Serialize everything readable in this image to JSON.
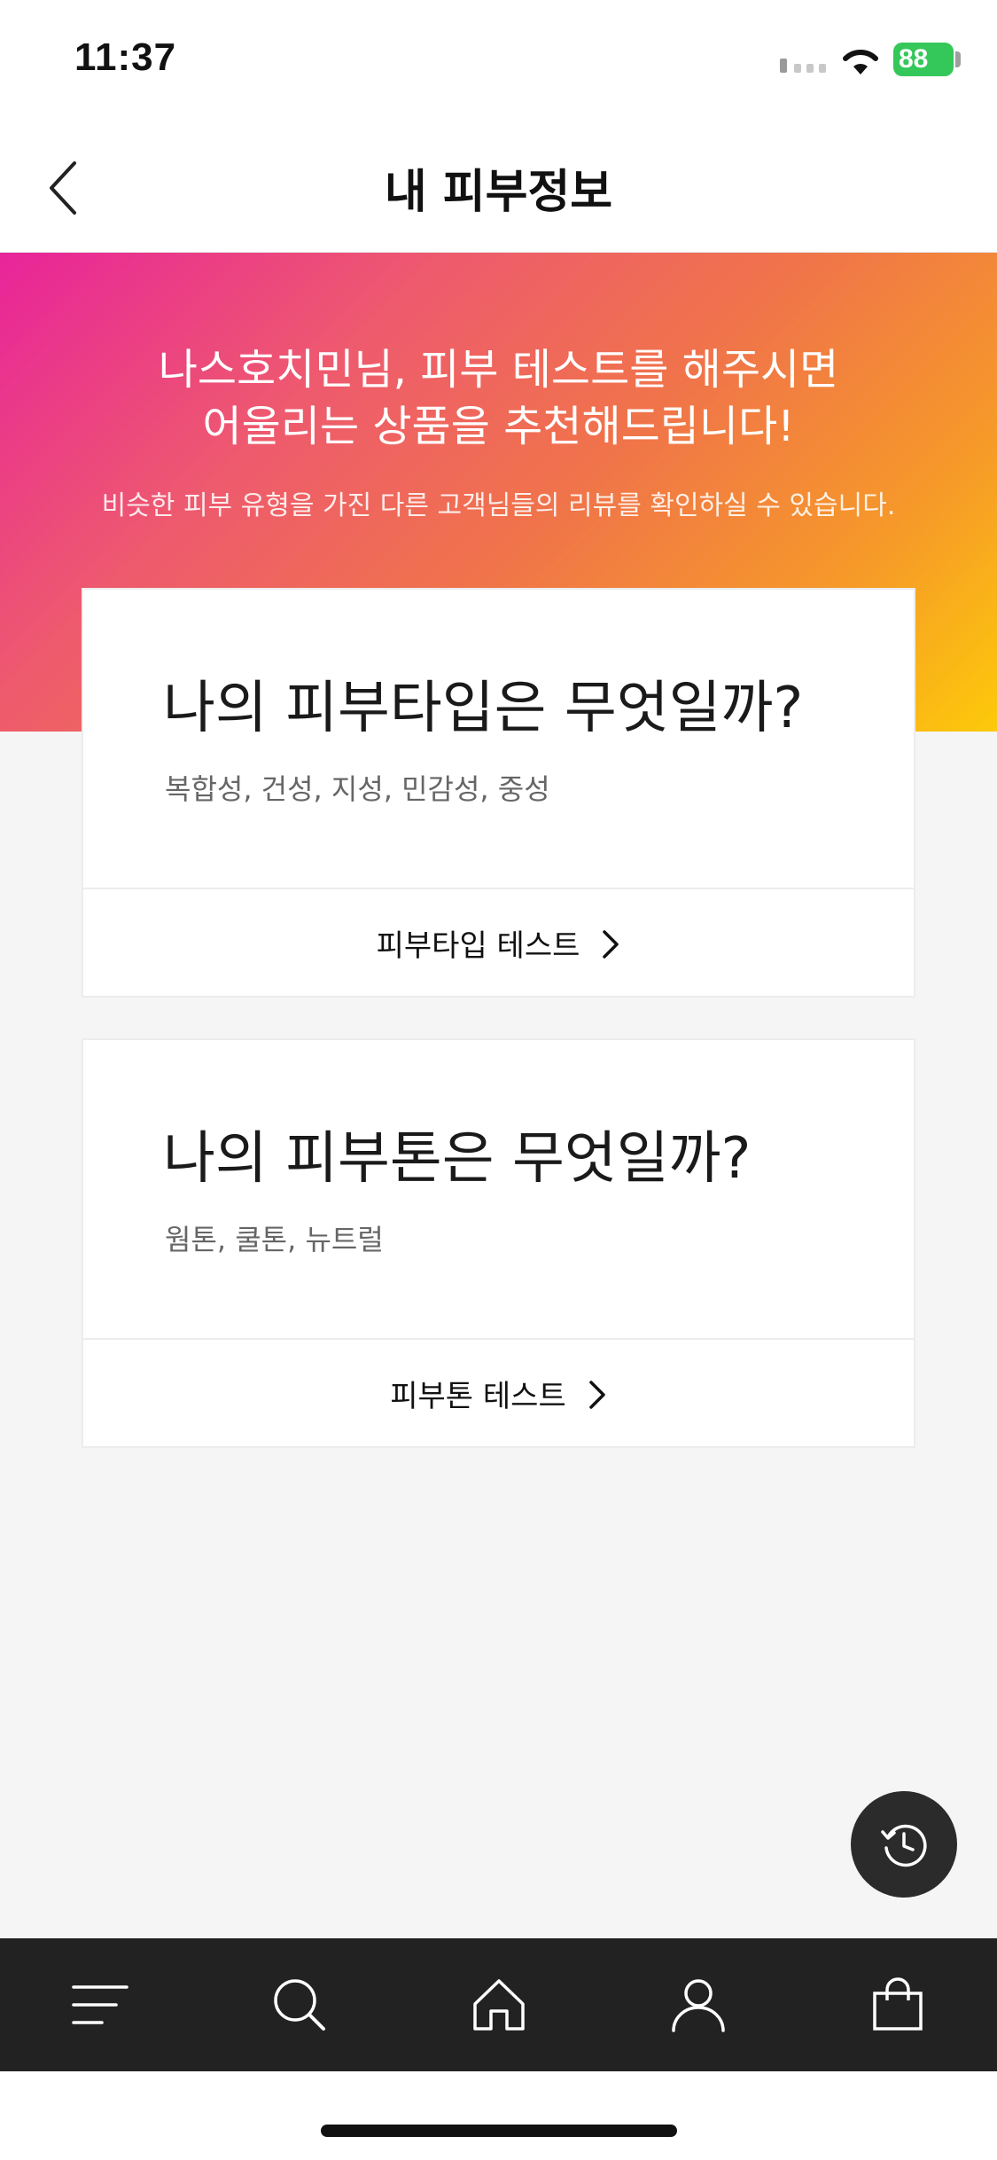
{
  "status_bar": {
    "time": "11:37",
    "battery_level": "88",
    "battery_color": "#34c759"
  },
  "header": {
    "title": "내 피부정보",
    "back_icon": "chevron-left-icon"
  },
  "hero": {
    "headline_line1": "나스호치민님, 피부 테스트를 해주시면",
    "headline_line2": "어울리는 상품을 추천해드립니다!",
    "subtext": "비슷한 피부 유형을 가진 다른 고객님들의 리뷰를 확인하실 수 있습니다.",
    "gradient_colors": [
      "#e8249a",
      "#f0744a",
      "#fdca0a"
    ]
  },
  "cards": [
    {
      "title": "나의 피부타입은 무엇일까?",
      "description": "복합성, 건성, 지성, 민감성, 중성",
      "cta_label": "피부타입 테스트"
    },
    {
      "title": "나의 피부톤은 무엇일까?",
      "description": "웜톤, 쿨톤, 뉴트럴",
      "cta_label": "피부톤 테스트"
    }
  ],
  "fab": {
    "icon": "history-icon"
  },
  "tab_bar": {
    "background": "#222222",
    "items": [
      {
        "icon": "menu-icon"
      },
      {
        "icon": "search-icon"
      },
      {
        "icon": "home-icon"
      },
      {
        "icon": "user-icon"
      },
      {
        "icon": "shopping-bag-icon"
      }
    ]
  }
}
